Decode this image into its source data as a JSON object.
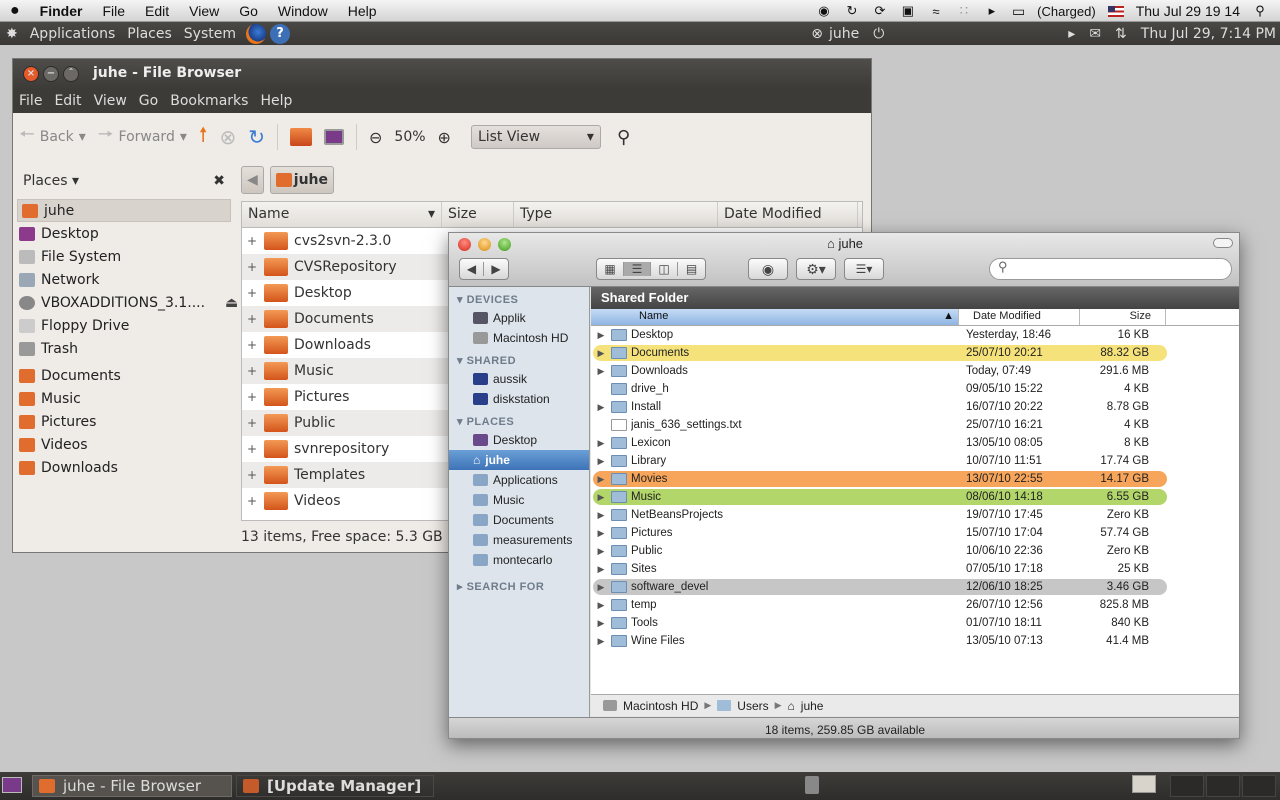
{
  "mac_menubar": {
    "apple": "",
    "items": [
      "Finder",
      "File",
      "Edit",
      "View",
      "Go",
      "Window",
      "Help"
    ],
    "battery": "(Charged)",
    "clock": "Thu Jul 29  19 14"
  },
  "ubuntu_panel": {
    "menus": [
      "Applications",
      "Places",
      "System"
    ],
    "user": "juhe",
    "clock": "Thu Jul 29,  7:14 PM"
  },
  "nautilus": {
    "title": "juhe - File Browser",
    "menu": [
      "File",
      "Edit",
      "View",
      "Go",
      "Bookmarks",
      "Help"
    ],
    "toolbar": {
      "back": "Back",
      "forward": "Forward",
      "zoom": "50%",
      "view_mode": "List View"
    },
    "places_label": "Places",
    "places": [
      {
        "label": "juhe",
        "color": "#e06c2e"
      },
      {
        "label": "Desktop",
        "color": "#8c3a8c"
      },
      {
        "label": "File System",
        "color": "#bbbbbb"
      },
      {
        "label": "Network",
        "color": "#9aa7b5"
      },
      {
        "label": "VBOXADDITIONS_3.1....",
        "color": "#888888"
      },
      {
        "label": "Floppy Drive",
        "color": "#cccccc"
      },
      {
        "label": "Trash",
        "color": "#999999"
      },
      {
        "label": "Documents",
        "color": "#e06c2e"
      },
      {
        "label": "Music",
        "color": "#e06c2e"
      },
      {
        "label": "Pictures",
        "color": "#e06c2e"
      },
      {
        "label": "Videos",
        "color": "#e06c2e"
      },
      {
        "label": "Downloads",
        "color": "#e06c2e"
      }
    ],
    "path_button": "juhe",
    "columns": [
      "Name",
      "Size",
      "Type",
      "Date Modified"
    ],
    "files": [
      "cvs2svn-2.3.0",
      "CVSRepository",
      "Desktop",
      "Documents",
      "Downloads",
      "Music",
      "Pictures",
      "Public",
      "svnrepository",
      "Templates",
      "Videos"
    ],
    "status": "13 items, Free space: 5.3 GB"
  },
  "finder": {
    "title": "juhe",
    "search_placeholder": "",
    "sections": {
      "devices": "DEVICES",
      "shared": "SHARED",
      "places": "PLACES",
      "search": "SEARCH FOR"
    },
    "devices": [
      "Applik",
      "Macintosh HD"
    ],
    "shared": [
      "aussik",
      "diskstation"
    ],
    "places": [
      "Desktop",
      "juhe",
      "Applications",
      "Music",
      "Documents",
      "measurements",
      "montecarlo"
    ],
    "header": "Shared Folder",
    "columns": {
      "name": "Name",
      "date": "Date Modified",
      "size": "Size"
    },
    "rows": [
      {
        "name": "Desktop",
        "date": "Yesterday, 18:46",
        "size": "16 KB",
        "label": "",
        "folder": true,
        "expand": true
      },
      {
        "name": "Documents",
        "date": "25/07/10 20:21",
        "size": "88.32 GB",
        "label": "#f5e27a",
        "folder": true,
        "expand": true
      },
      {
        "name": "Downloads",
        "date": "Today, 07:49",
        "size": "291.6 MB",
        "label": "",
        "folder": true,
        "expand": true
      },
      {
        "name": "drive_h",
        "date": "09/05/10 15:22",
        "size": "4 KB",
        "label": "",
        "folder": true,
        "expand": false
      },
      {
        "name": "Install",
        "date": "16/07/10 20:22",
        "size": "8.78 GB",
        "label": "",
        "folder": true,
        "expand": true
      },
      {
        "name": "janis_636_settings.txt",
        "date": "25/07/10 16:21",
        "size": "4 KB",
        "label": "",
        "folder": false,
        "expand": false
      },
      {
        "name": "Lexicon",
        "date": "13/05/10 08:05",
        "size": "8 KB",
        "label": "",
        "folder": true,
        "expand": true
      },
      {
        "name": "Library",
        "date": "10/07/10 11:51",
        "size": "17.74 GB",
        "label": "",
        "folder": true,
        "expand": true
      },
      {
        "name": "Movies",
        "date": "13/07/10 22:55",
        "size": "14.17 GB",
        "label": "#f7a55a",
        "folder": true,
        "expand": true
      },
      {
        "name": "Music",
        "date": "08/06/10 14:18",
        "size": "6.55 GB",
        "label": "#b3d66b",
        "folder": true,
        "expand": true
      },
      {
        "name": "NetBeansProjects",
        "date": "19/07/10 17:45",
        "size": "Zero KB",
        "label": "",
        "folder": true,
        "expand": true
      },
      {
        "name": "Pictures",
        "date": "15/07/10 17:04",
        "size": "57.74 GB",
        "label": "",
        "folder": true,
        "expand": true
      },
      {
        "name": "Public",
        "date": "10/06/10 22:36",
        "size": "Zero KB",
        "label": "",
        "folder": true,
        "expand": true
      },
      {
        "name": "Sites",
        "date": "07/05/10 17:18",
        "size": "25 KB",
        "label": "",
        "folder": true,
        "expand": true
      },
      {
        "name": "software_devel",
        "date": "12/06/10 18:25",
        "size": "3.46 GB",
        "label": "#c6c6c6",
        "folder": true,
        "expand": true
      },
      {
        "name": "temp",
        "date": "26/07/10 12:56",
        "size": "825.8 MB",
        "label": "",
        "folder": true,
        "expand": true
      },
      {
        "name": "Tools",
        "date": "01/07/10 18:11",
        "size": "840 KB",
        "label": "",
        "folder": true,
        "expand": true
      },
      {
        "name": "Wine Files",
        "date": "13/05/10 07:13",
        "size": "41.4 MB",
        "label": "",
        "folder": true,
        "expand": true
      }
    ],
    "path": [
      "Macintosh HD",
      "Users",
      "juhe"
    ],
    "status": "18 items, 259.85 GB available"
  },
  "taskbar": {
    "tasks": [
      "juhe - File Browser",
      "[Update Manager]"
    ]
  }
}
